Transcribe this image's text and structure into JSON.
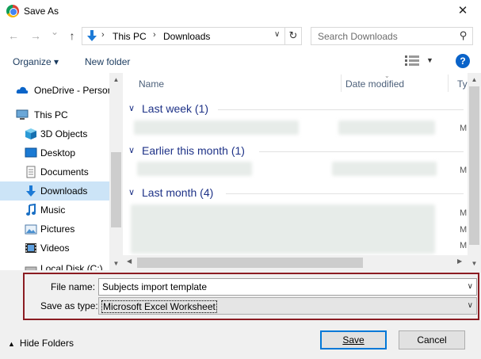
{
  "window": {
    "title": "Save As",
    "close_glyph": "✕"
  },
  "nav": {
    "back_glyph": "←",
    "forward_glyph": "→",
    "recent_glyph": "⌄",
    "up_glyph": "↑",
    "breadcrumbs": [
      "This PC",
      "Downloads"
    ],
    "crumb_sep": "›",
    "refresh_glyph": "↻",
    "search_placeholder": "Search Downloads"
  },
  "toolbar": {
    "organize_label": "Organize ▾",
    "new_folder_label": "New folder",
    "help_glyph": "?"
  },
  "sidebar": {
    "items": [
      {
        "label": "OneDrive - Person",
        "icon": "cloud-icon"
      },
      {
        "label": "This PC",
        "icon": "computer-icon"
      },
      {
        "label": "3D Objects",
        "icon": "cube-icon"
      },
      {
        "label": "Desktop",
        "icon": "desktop-icon"
      },
      {
        "label": "Documents",
        "icon": "document-icon"
      },
      {
        "label": "Downloads",
        "icon": "download-icon",
        "selected": true
      },
      {
        "label": "Music",
        "icon": "music-icon"
      },
      {
        "label": "Pictures",
        "icon": "pictures-icon"
      },
      {
        "label": "Videos",
        "icon": "video-icon"
      },
      {
        "label": "Local Disk (C:)",
        "icon": "drive-icon"
      }
    ]
  },
  "filelist": {
    "columns": [
      "Name",
      "Date modified",
      "Ty"
    ],
    "groups": [
      "Last week (1)",
      "Earlier this month (1)",
      "Last month (4)"
    ],
    "type_initial": "M"
  },
  "form": {
    "file_name_label": "File name:",
    "file_name_value": "Subjects import template",
    "save_as_type_label": "Save as type:",
    "save_as_type_value": "Microsoft Excel Worksheet"
  },
  "footer": {
    "hide_folders_label": "Hide Folders",
    "save_label": "Save",
    "cancel_label": "Cancel"
  },
  "colors": {
    "accent": "#0078d7",
    "highlight_border": "#8b1c22",
    "group_header": "#1e3287",
    "selected_bg": "#cce4f7"
  }
}
